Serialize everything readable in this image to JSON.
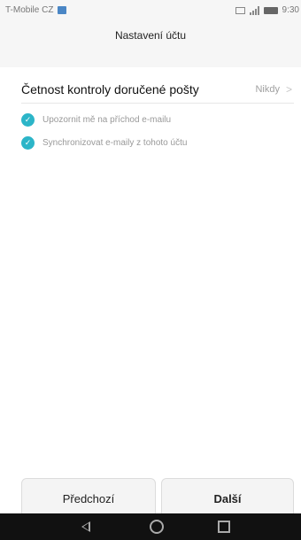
{
  "status_bar": {
    "carrier": "T-Mobile CZ",
    "time": "9:30",
    "icons": [
      "carrier-notification-icon",
      "image-icon",
      "signal-icon",
      "battery-icon"
    ]
  },
  "header": {
    "title": "Nastavení účtu"
  },
  "settings": {
    "frequency": {
      "label": "Četnost kontroly doručené pošty",
      "value": "Nikdy"
    },
    "checkboxes": [
      {
        "label": "Upozornit mě na příchod e-mailu",
        "checked": true
      },
      {
        "label": "Synchronizovat e-maily z tohoto účtu",
        "checked": true
      }
    ]
  },
  "buttons": {
    "prev": "Předchozí",
    "next": "Další"
  },
  "nav_bar": {
    "icons": [
      "back-icon",
      "home-icon",
      "recent-apps-icon"
    ]
  },
  "colors": {
    "accent": "#2cb5c8",
    "header_bg": "#f6f6f6",
    "nav_bg": "#111111"
  }
}
